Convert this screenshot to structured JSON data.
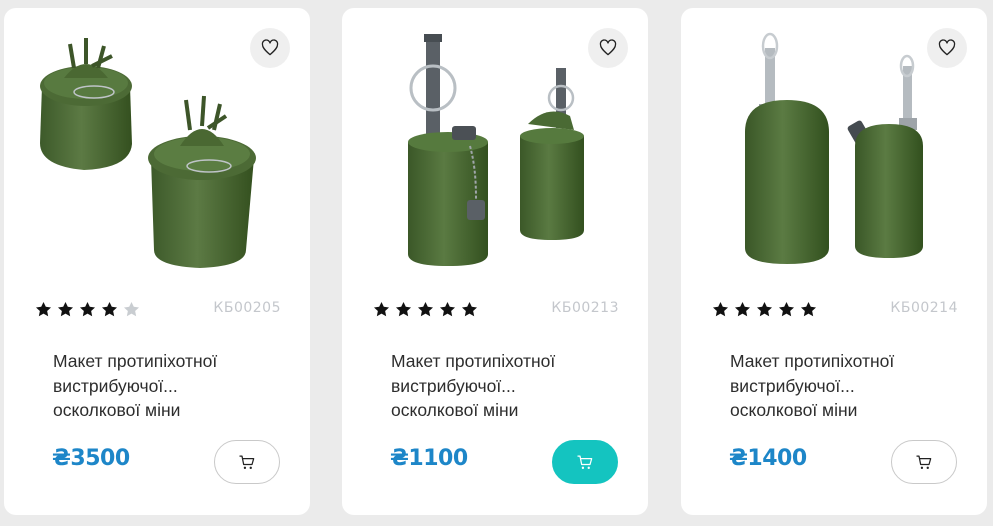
{
  "products": [
    {
      "sku": "КБ00205",
      "title": "Макет протипіхотної вистрибуючої осколкової міни",
      "title_line1": "Макет протипіхотної",
      "title_line2": "вистрибуючої...",
      "title_line3": "осколкової міни",
      "price": "₴3500",
      "rating": 4,
      "rating_max": 5,
      "favorite_icon": "heart-outline-icon",
      "cart_icon": "cart-icon",
      "cart_active": false
    },
    {
      "sku": "КБ00213",
      "title": "Макет протипіхотної вистрибуючої осколкової міни",
      "title_line1": "Макет протипіхотної",
      "title_line2": "вистрибуючої...",
      "title_line3": "осколкової міни",
      "price": "₴1100",
      "rating": 5,
      "rating_max": 5,
      "favorite_icon": "heart-outline-icon",
      "cart_icon": "cart-icon",
      "cart_active": true
    },
    {
      "sku": "КБ00214",
      "title": "Макет протипіхотної вистрибуючої осколкової міни",
      "title_line1": "Макет протипіхотної",
      "title_line2": "вистрибуючої...",
      "title_line3": "осколкової міни",
      "price": "₴1400",
      "rating": 5,
      "rating_max": 5,
      "favorite_icon": "heart-outline-icon",
      "cart_icon": "cart-icon",
      "cart_active": false
    }
  ],
  "colors": {
    "page_background": "#ebebeb",
    "card_background": "#ffffff",
    "price": "#1d86c8",
    "sku": "#c4c7cc",
    "star_filled": "#111111",
    "star_empty": "#c9cdd1",
    "cart_active": "#14c4c0",
    "mine_green": "#4f6b38"
  }
}
